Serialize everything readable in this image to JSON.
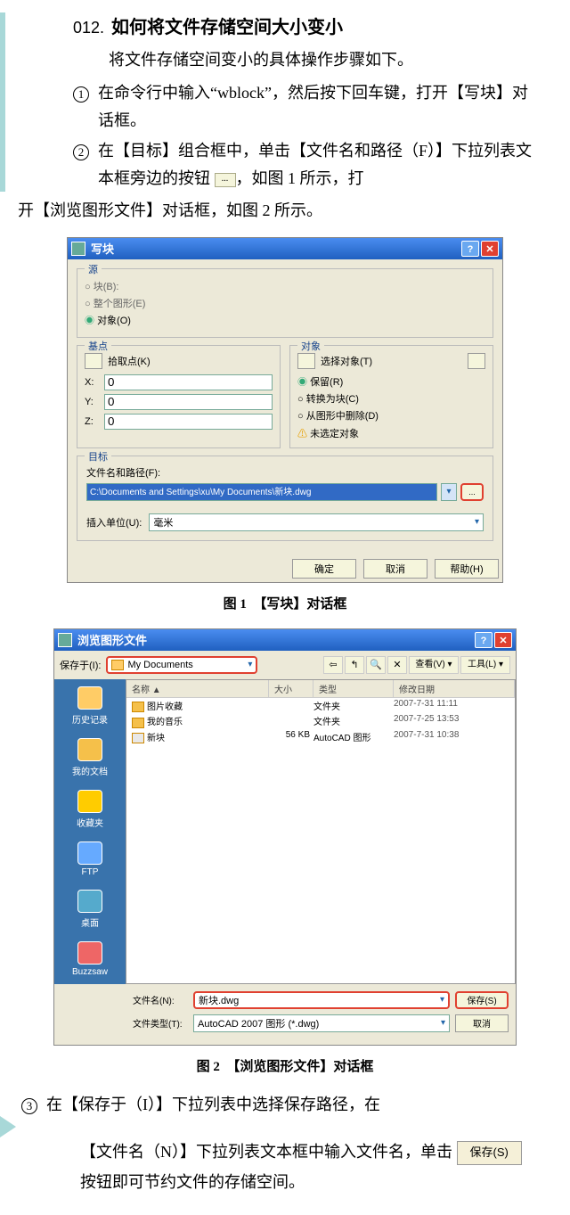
{
  "title_num": "012.",
  "title_text": "如何将文件存储空间大小变小",
  "intro": "将文件存储空间变小的具体操作步骤如下。",
  "step1_a": "在命令行中输入“wblock”，然后按下回车键，打开【写块】对话框。",
  "step2_a": "在【目标】组合框中，单击【文件名和路径（F）】下拉列表文本框旁边的按钮",
  "step2_b": "，如图 1 所示，打",
  "cont_text": "开【浏览图形文件】对话框，如图 2 所示。",
  "dlg1": {
    "title": "写块",
    "src_title": "源",
    "r_block": "块(B):",
    "r_whole": "整个图形(E)",
    "r_obj": "对象(O)",
    "base_title": "基点",
    "pick": "拾取点(K)",
    "x": "X:",
    "y": "Y:",
    "z": "Z:",
    "cx": "0",
    "cy": "0",
    "cz": "0",
    "obj_title": "对象",
    "sel": "选择对象(T)",
    "keep": "保留(R)",
    "conv": "转换为块(C)",
    "del": "从图形中删除(D)",
    "warn": "未选定对象",
    "dest_title": "目标",
    "path_lbl": "文件名和路径(F):",
    "path_val": "C:\\Documents and Settings\\xu\\My Documents\\新块.dwg",
    "unit_lbl": "插入单位(U):",
    "unit_val": "毫米",
    "ok": "确定",
    "cancel": "取消",
    "help": "帮助(H)"
  },
  "cap1": "图 1　【写块】对话框",
  "dlg2": {
    "title": "浏览图形文件",
    "save_in_lbl": "保存于(I):",
    "folder": "My Documents",
    "back": "⇦",
    "up": "↰",
    "search": "🔍",
    "del": "✕",
    "views": "查看(V) ▾",
    "tools": "工具(L) ▾",
    "sb1": "历史记录",
    "sb2": "我的文档",
    "sb3": "收藏夹",
    "sb4": "FTP",
    "sb5": "桌面",
    "sb6": "Buzzsaw",
    "h_name": "名称 ▲",
    "h_size": "大小",
    "h_type": "类型",
    "h_date": "修改日期",
    "f1": "图片收藏",
    "f1t": "文件夹",
    "f1d": "2007-7-31 11:11",
    "f2": "我的音乐",
    "f2t": "文件夹",
    "f2d": "2007-7-25 13:53",
    "f3": "新块",
    "f3s": "56 KB",
    "f3t": "AutoCAD 图形",
    "f3d": "2007-7-31 10:38",
    "fn_lbl": "文件名(N):",
    "fn_val": "新块.dwg",
    "ft_lbl": "文件类型(T):",
    "ft_val": "AutoCAD 2007 图形 (*.dwg)",
    "save": "保存(S)",
    "cancel": "取消"
  },
  "cap2": "图 2　【浏览图形文件】对话框",
  "step3_text": "在【保存于（I）】下拉列表中选择保存路径，在",
  "final_a": "【文件名（N）】下拉列表文本框中输入文件名，单击",
  "save_btn": "保存(S)",
  "final_b": "按钮即可节约文件的存储空间。"
}
